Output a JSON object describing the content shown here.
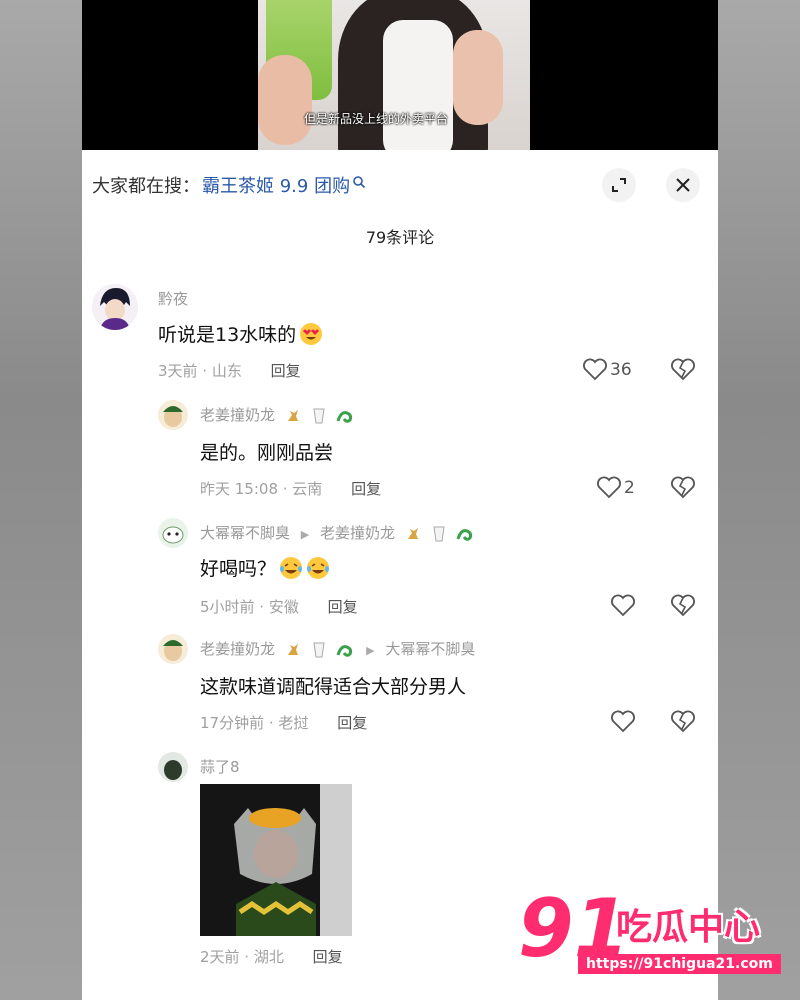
{
  "video": {
    "subtitle": "但是新品没上线的外卖平台"
  },
  "header": {
    "search_prefix": "大家都在搜：",
    "search_keyword": "霸王茶姬 9.9 团购",
    "comment_count": "79条评论"
  },
  "comments": [
    {
      "user": "黔夜",
      "text": "听说是13水味的",
      "time": "3天前 · 山东",
      "reply": "回复",
      "likes": "36"
    },
    {
      "user": "老姜撞奶龙",
      "text": "是的。刚刚品尝",
      "time": "昨天 15:08 · 云南",
      "reply": "回复",
      "likes": "2"
    },
    {
      "user": "大幂幂不脚臭",
      "reply_to": "老姜撞奶龙",
      "text": "好喝吗？",
      "time": "5小时前 · 安徽",
      "reply": "回复",
      "likes": ""
    },
    {
      "user": "老姜撞奶龙",
      "reply_to": "大幂幂不脚臭",
      "text": "这款味道调配得适合大部分男人",
      "time": "17分钟前 · 老挝",
      "reply": "回复",
      "likes": ""
    },
    {
      "user": "蒜了8",
      "text": "",
      "time": "2天前 · 湖北",
      "reply": "回复",
      "likes": ""
    }
  ],
  "watermark": {
    "number": "91",
    "text": "吃瓜中心",
    "url": "https://91chigua21.com"
  },
  "colors": {
    "accent_keyword": "#2a5aa8",
    "watermark": "#ff2d6f"
  }
}
